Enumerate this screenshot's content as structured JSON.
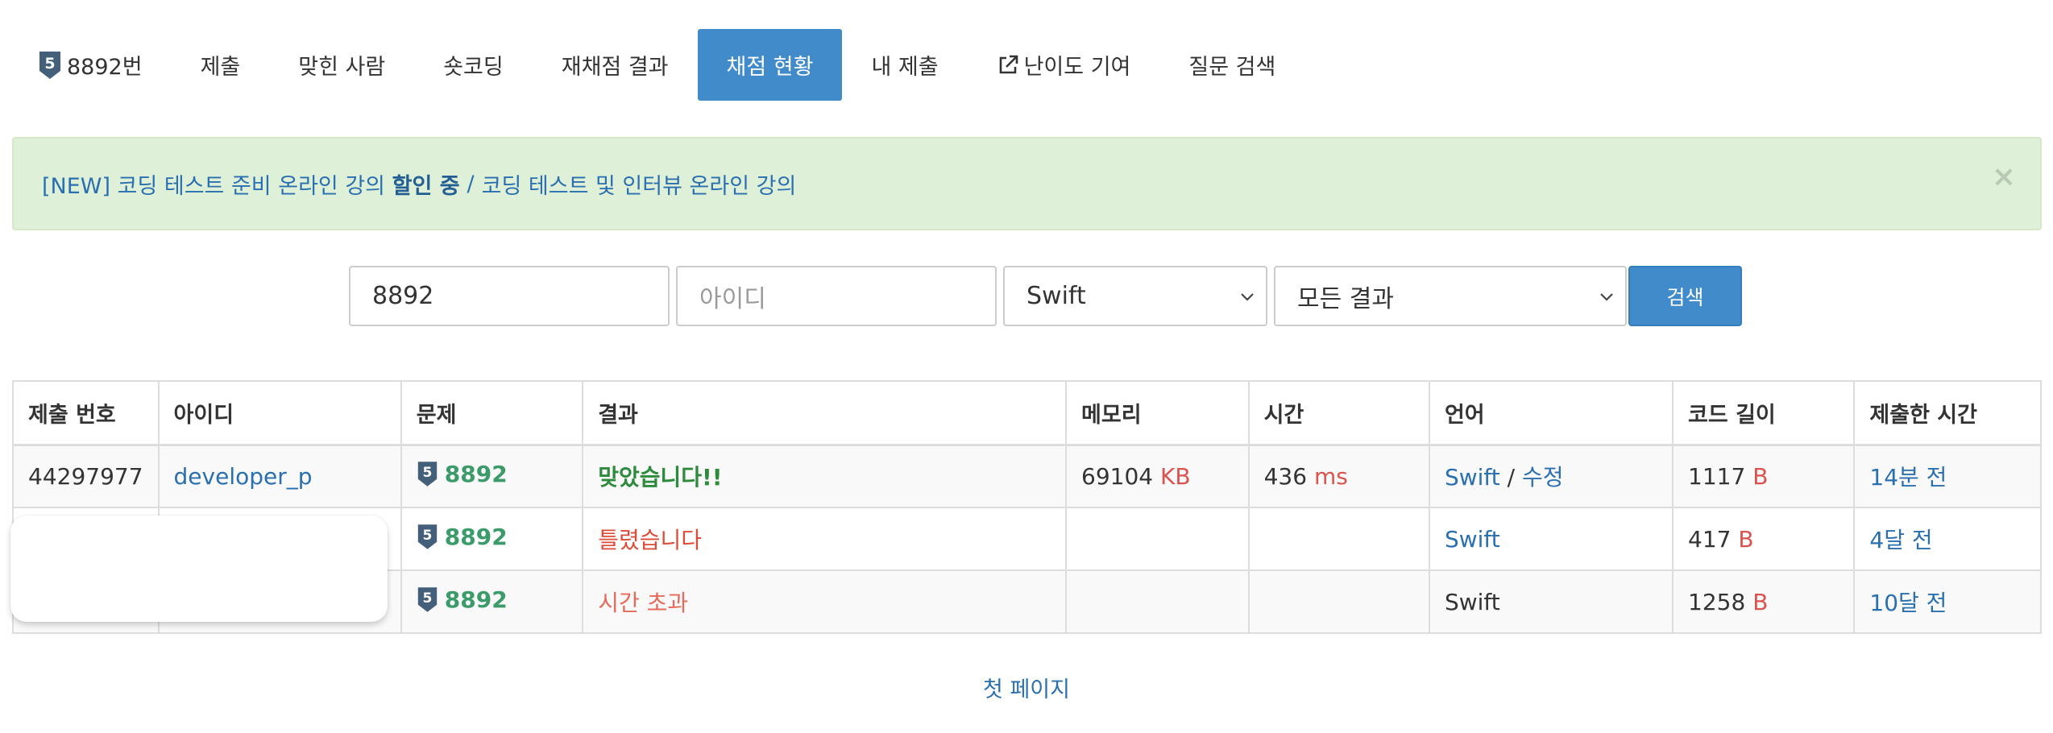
{
  "nav": {
    "problem_label": "8892번",
    "problem_tier_digit": "5",
    "items": [
      {
        "label": "제출"
      },
      {
        "label": "맞힌 사람"
      },
      {
        "label": "숏코딩"
      },
      {
        "label": "재채점 결과"
      },
      {
        "label": "채점 현황",
        "active": true
      },
      {
        "label": "내 제출"
      },
      {
        "label": "난이도 기여",
        "icon": "external-link-icon"
      },
      {
        "label": "질문 검색"
      }
    ]
  },
  "alert": {
    "part1": "[NEW] 코딩 테스트 준비 온라인 강의 ",
    "part1_strong": "할인 중",
    "separator": "/",
    "part2": "코딩 테스트 및 인터뷰 온라인 강의",
    "close": "×"
  },
  "search": {
    "problem_value": "8892",
    "user_placeholder": "아이디",
    "language_selected": "Swift",
    "result_selected": "모든 결과",
    "button_label": "검색"
  },
  "table": {
    "headers": [
      "제출 번호",
      "아이디",
      "문제",
      "결과",
      "메모리",
      "시간",
      "언어",
      "코드 길이",
      "제출한 시간"
    ],
    "rows": [
      {
        "submission_id": "44297977",
        "user": "developer_p",
        "problem": "8892",
        "result": "맞았습니다!!",
        "memory": "69104",
        "memory_unit": "KB",
        "time": "436",
        "time_unit": "ms",
        "language": "Swift",
        "language_sep": "/",
        "language_edit": "수정",
        "code_length": "1117",
        "code_unit": "B",
        "submitted": "14분 전"
      },
      {
        "submission_id": "",
        "user": "",
        "problem": "8892",
        "result": "틀렸습니다",
        "memory": "",
        "memory_unit": "",
        "time": "",
        "time_unit": "",
        "language": "Swift",
        "code_length": "417",
        "code_unit": "B",
        "submitted": "4달 전"
      },
      {
        "submission_id": "",
        "user": "",
        "problem": "8892",
        "result": "시간 초과",
        "memory": "",
        "memory_unit": "",
        "time": "",
        "time_unit": "",
        "language": "Swift",
        "code_length": "1258",
        "code_unit": "B",
        "submitted": "10달 전"
      }
    ]
  },
  "pager": {
    "first_page": "첫 페이지"
  },
  "colors": {
    "primary": "#428bca",
    "alert_bg": "#dff0d8",
    "accepted": "#2e8b3e",
    "wrong": "#dd4b39",
    "unit": "#d9534f",
    "link": "#2a6fb0"
  }
}
